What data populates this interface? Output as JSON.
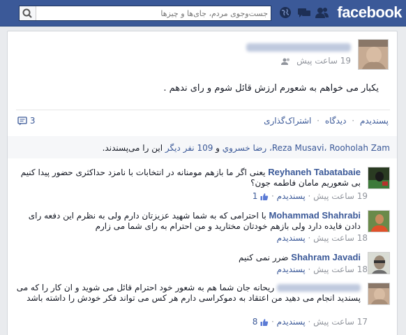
{
  "header": {
    "logo": "facebook",
    "search_placeholder": "جست‌وجوی مردم، جای‌ها و چیزها"
  },
  "post": {
    "time": "19 ساعت پیش",
    "text": "یکبار می خواهم به شعورم ارزش قائل شوم و رای ندهم .",
    "actions": [
      "پسندیدم",
      "دیدگاه",
      "اشتراک‌گذاری"
    ],
    "comment_count": "3"
  },
  "likes": {
    "names": "Reza Musavi، Rooholah Zam، رضا خسروي",
    "and": " و ",
    "others": "109 نفر دیگر",
    "tail": " این را می‌پسندند."
  },
  "comments": [
    {
      "name": "Reyhaneh Tabatabaie",
      "text": "یعنی اگر ما بازهم مومنانه در انتخابات با نامزد حداکثری حضور پیدا کنیم بی شعوریم مامان فاطمه جون؟",
      "time": "19 ساعت پیش",
      "like_label": "پسندیدم",
      "likes": "1"
    },
    {
      "name": "Mohammad Shahrabi",
      "text": "با احترامی که به شما شهید عزیزتان دارم ولی به نظرم این دفعه رای دادن فایده دارد ولی بازهم خودتان مختارید و من احترام به رای شما می زارم",
      "time": "18 ساعت پیش",
      "like_label": "پسندیدم"
    },
    {
      "name": "Shahram Javadi",
      "text": "ضرر نمی کنیم",
      "time": "18 ساعت پیش",
      "like_label": "پسندیدم"
    },
    {
      "text": "ریحانه جان شما هم به شعور خود احترام قائل می شوید و ان کار را که می پسندید انجام می دهید من اعتقاد به دموکراسی دارم هر کس می تواند فکر خودش را داشته باشد",
      "time": "17 ساعت پیش",
      "like_label": "پسندیدم",
      "likes": "8"
    }
  ],
  "colors": {
    "brand": "#3b5998",
    "link": "#3b5998",
    "meta": "#90949c"
  }
}
